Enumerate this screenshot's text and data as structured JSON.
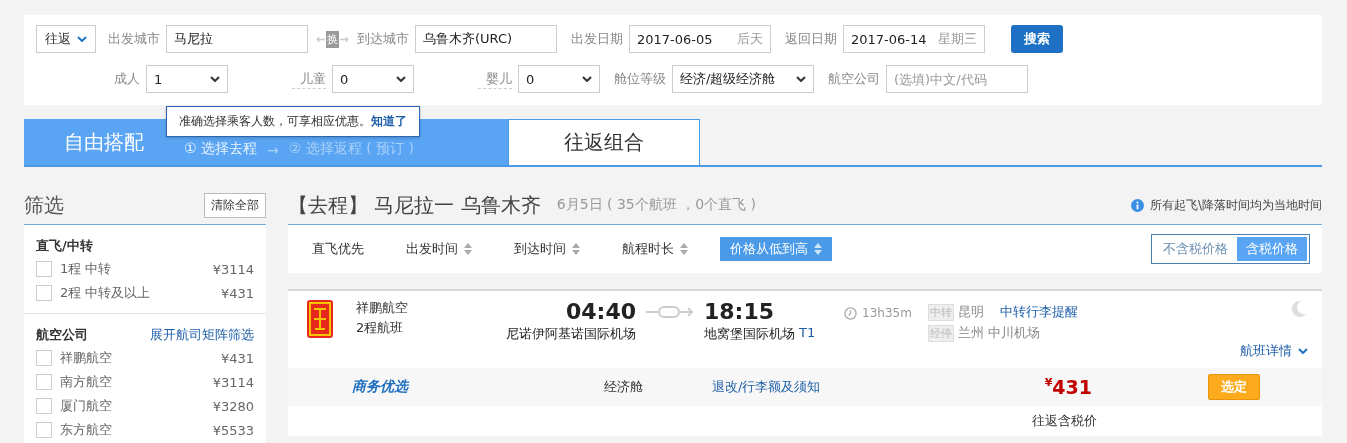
{
  "search": {
    "trip_type": "往返",
    "from_label": "出发城市",
    "from": "马尼拉",
    "swap": "换",
    "to_label": "到达城市",
    "to": "乌鲁木齐(URC)",
    "depart_label": "出发日期",
    "depart": "2017-06-05",
    "depart_hint": "后天",
    "return_label": "返回日期",
    "return": "2017-06-14",
    "return_hint": "星期三",
    "search_button": "搜索",
    "passengers": [
      {
        "label": "成人",
        "value": "1"
      },
      {
        "label": "儿童",
        "value": "0"
      },
      {
        "label": "婴儿",
        "value": "0"
      }
    ],
    "cabin_label": "舱位等级",
    "cabin": "经济/超级经济舱",
    "airline_label": "航空公司",
    "airline_placeholder": "(选填)中文/代码"
  },
  "tooltip": {
    "text": "准确选择乘客人数，可享相应优惠。",
    "link": "知道了"
  },
  "tabs": [
    {
      "label": "自由搭配",
      "selected": true
    },
    {
      "label": "往返组合",
      "selected": false
    }
  ],
  "steps": [
    {
      "label": "① 选择去程",
      "selected": true
    },
    {
      "label": "② 选择返程 ( 预订 )",
      "selected": false
    }
  ],
  "step_arrow": "→",
  "sidebar": {
    "title": "筛选",
    "clear_button": "清除全部",
    "groups": [
      {
        "title": "直飞/中转",
        "items": [
          {
            "label": "1程 中转",
            "price": "¥3114",
            "checked": false
          },
          {
            "label": "2程 中转及以上",
            "price": "¥431",
            "checked": false
          }
        ]
      },
      {
        "title": "航空公司",
        "link": "展开航司矩阵筛选",
        "items": [
          {
            "label": "祥鹏航空",
            "price": "¥431",
            "checked": false
          },
          {
            "label": "南方航空",
            "price": "¥3114",
            "checked": false
          },
          {
            "label": "厦门航空",
            "price": "¥3280",
            "checked": false
          },
          {
            "label": "东方航空",
            "price": "¥5533",
            "checked": false
          }
        ]
      }
    ]
  },
  "results": {
    "heading": "【去程】 马尼拉一 乌鲁木齐",
    "summary": "6月5日 ( 35个航班 ，0个直飞 )",
    "note": "所有起飞\\降落时间均为当地时间",
    "sort_options": [
      {
        "label": "直飞优先",
        "sortable": false,
        "selected": false
      },
      {
        "label": "出发时间",
        "sortable": true,
        "selected": false
      },
      {
        "label": "到达时间",
        "sortable": true,
        "selected": false
      },
      {
        "label": "航程时长",
        "sortable": true,
        "selected": false
      },
      {
        "label": "价格从低到高",
        "sortable": true,
        "selected": true
      }
    ],
    "price_modes": [
      {
        "label": "不含税价格",
        "selected": false
      },
      {
        "label": "含税价格",
        "selected": true
      }
    ],
    "flights": [
      {
        "airline": "祥鹏航空",
        "segments": "2程航班",
        "depart_time": "04:40",
        "depart_airport": "尼诺伊阿基诺国际机场",
        "arrive_time": "18:15",
        "arrive_airport": "地窝堡国际机场",
        "terminal": "T1",
        "duration": "13h35m",
        "stops": [
          {
            "tag": "中转",
            "place": "昆明",
            "link": "中转行李提醒"
          },
          {
            "tag": "经停",
            "place": "兰州 中川机场"
          }
        ],
        "details_link": "航班详情",
        "badge": "商务优选",
        "cabin": "经济舱",
        "rules_link": "退改/行李额及须知",
        "currency": "¥",
        "price": "431",
        "select_button": "选定",
        "price_note": "往返含税价"
      }
    ]
  }
}
